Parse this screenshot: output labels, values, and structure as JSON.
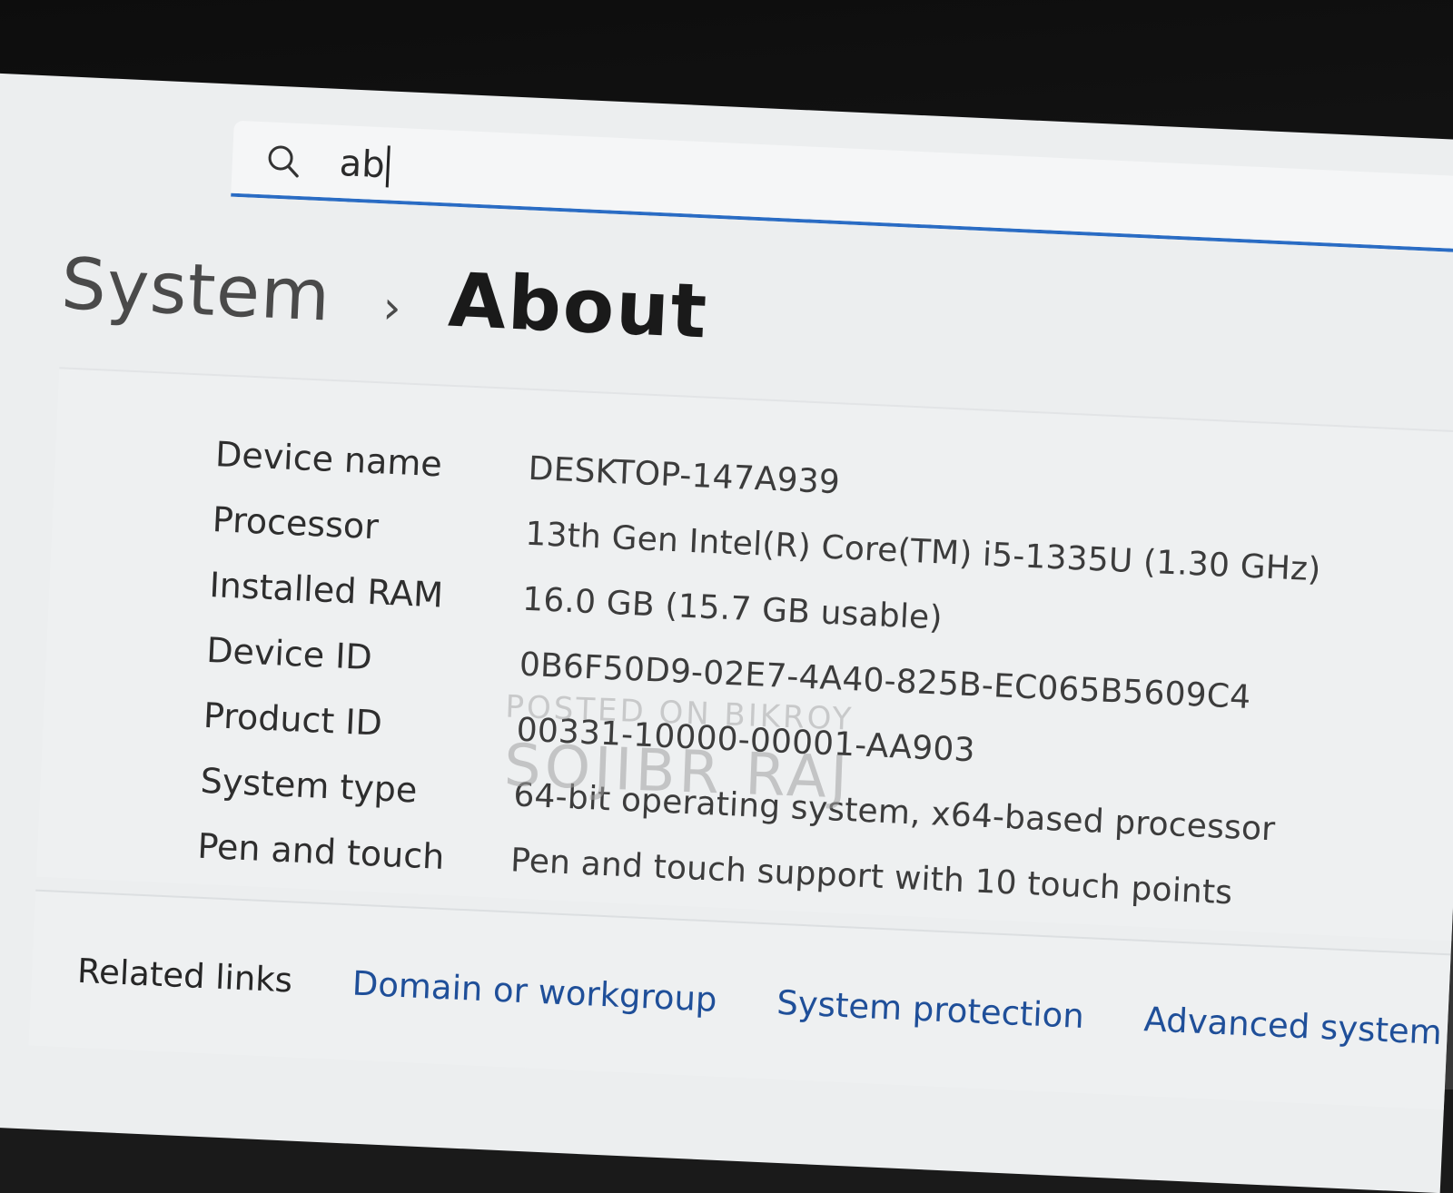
{
  "search": {
    "query": "ab"
  },
  "breadcrumb": {
    "parent": "System",
    "separator": "›",
    "current": "About"
  },
  "specs": [
    {
      "label": "Device name",
      "value": "DESKTOP-147A939"
    },
    {
      "label": "Processor",
      "value": "13th Gen Intel(R) Core(TM) i5-1335U (1.30 GHz)"
    },
    {
      "label": "Installed RAM",
      "value": "16.0 GB (15.7 GB usable)"
    },
    {
      "label": "Device ID",
      "value": "0B6F50D9-02E7-4A40-825B-EC065B5609C4"
    },
    {
      "label": "Product ID",
      "value": "00331-10000-00001-AA903"
    },
    {
      "label": "System type",
      "value": "64-bit operating system, x64-based processor"
    },
    {
      "label": "Pen and touch",
      "value": "Pen and touch support with 10 touch points"
    }
  ],
  "related": {
    "label": "Related links",
    "links": [
      "Domain or workgroup",
      "System protection",
      "Advanced system sett"
    ]
  },
  "watermark": {
    "line1": "POSTED ON BIKROY",
    "line2": "SOJIBR RAJ"
  },
  "colors": {
    "accent": "#2a6cc4",
    "link": "#1f4f99",
    "background": "#eceeef"
  },
  "icons": {
    "search": "search-icon",
    "breadcrumb_separator": "chevron-right-icon"
  }
}
